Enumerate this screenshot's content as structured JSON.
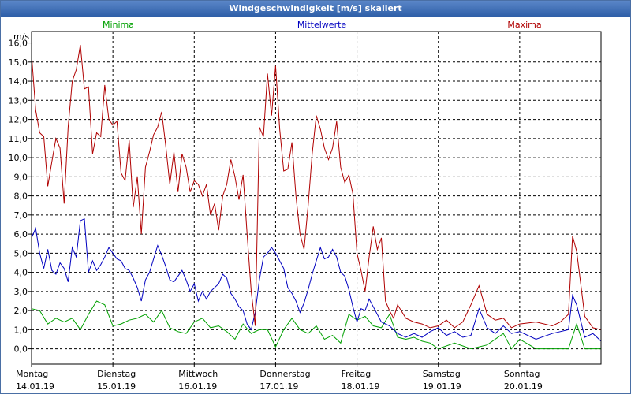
{
  "chart_data": {
    "type": "line",
    "title": "Windgeschwindigkeit [m/s] skaliert",
    "ylabel": "m/s",
    "ylim": [
      -0.8,
      16.6
    ],
    "yticks": [
      "0,0",
      "1,0",
      "2,0",
      "3,0",
      "4,0",
      "5,0",
      "6,0",
      "7,0",
      "8,0",
      "9,0",
      "10,0",
      "11,0",
      "12,0",
      "13,0",
      "14,0",
      "15,0",
      "16,0"
    ],
    "x_days": [
      {
        "day": "Montag",
        "date": "14.01.19"
      },
      {
        "day": "Dienstag",
        "date": "15.01.19"
      },
      {
        "day": "Mittwoch",
        "date": "16.01.19"
      },
      {
        "day": "Donnerstag",
        "date": "17.01.19"
      },
      {
        "day": "Freitag",
        "date": "18.01.19"
      },
      {
        "day": "Samstag",
        "date": "19.01.19"
      },
      {
        "day": "Sonntag",
        "date": "20.01.19"
      }
    ],
    "grid": true,
    "legend": "top",
    "series": [
      {
        "name": "Minima",
        "color": "#00a000",
        "points": [
          [
            14.0,
            2.1
          ],
          [
            14.1,
            2.0
          ],
          [
            14.2,
            1.3
          ],
          [
            14.3,
            1.6
          ],
          [
            14.4,
            1.4
          ],
          [
            14.5,
            1.6
          ],
          [
            14.6,
            1.0
          ],
          [
            14.7,
            1.8
          ],
          [
            14.8,
            2.5
          ],
          [
            14.9,
            2.3
          ],
          [
            15.0,
            1.2
          ],
          [
            15.1,
            1.3
          ],
          [
            15.2,
            1.5
          ],
          [
            15.3,
            1.6
          ],
          [
            15.4,
            1.8
          ],
          [
            15.5,
            1.4
          ],
          [
            15.6,
            2.0
          ],
          [
            15.7,
            1.1
          ],
          [
            15.8,
            0.9
          ],
          [
            15.9,
            0.8
          ],
          [
            16.0,
            1.4
          ],
          [
            16.1,
            1.6
          ],
          [
            16.2,
            1.1
          ],
          [
            16.3,
            1.2
          ],
          [
            16.4,
            0.9
          ],
          [
            16.5,
            0.5
          ],
          [
            16.6,
            1.3
          ],
          [
            16.7,
            0.8
          ],
          [
            16.8,
            1.0
          ],
          [
            16.9,
            1.0
          ],
          [
            17.0,
            0.1
          ],
          [
            17.1,
            1.0
          ],
          [
            17.2,
            1.6
          ],
          [
            17.3,
            1.0
          ],
          [
            17.4,
            0.8
          ],
          [
            17.5,
            1.2
          ],
          [
            17.6,
            0.5
          ],
          [
            17.7,
            0.7
          ],
          [
            17.8,
            0.3
          ],
          [
            17.9,
            1.8
          ],
          [
            18.0,
            1.5
          ],
          [
            18.1,
            1.7
          ],
          [
            18.2,
            1.2
          ],
          [
            18.3,
            1.1
          ],
          [
            18.4,
            1.8
          ],
          [
            18.5,
            0.6
          ],
          [
            18.6,
            0.5
          ],
          [
            18.7,
            0.6
          ],
          [
            18.8,
            0.4
          ],
          [
            18.9,
            0.3
          ],
          [
            19.0,
            0.0
          ],
          [
            19.2,
            0.3
          ],
          [
            19.4,
            0.0
          ],
          [
            19.6,
            0.2
          ],
          [
            19.8,
            0.8
          ],
          [
            19.9,
            0.0
          ],
          [
            20.0,
            0.5
          ],
          [
            20.2,
            0.0
          ],
          [
            20.4,
            0.0
          ],
          [
            20.6,
            0.0
          ],
          [
            20.7,
            1.3
          ],
          [
            20.8,
            0.0
          ],
          [
            21.0,
            0.0
          ]
        ]
      },
      {
        "name": "Mittelwerte",
        "color": "#0000c0",
        "points": [
          [
            14.0,
            5.8
          ],
          [
            14.05,
            6.3
          ],
          [
            14.1,
            5.0
          ],
          [
            14.15,
            4.2
          ],
          [
            14.2,
            5.2
          ],
          [
            14.25,
            4.1
          ],
          [
            14.3,
            3.9
          ],
          [
            14.35,
            4.5
          ],
          [
            14.4,
            4.2
          ],
          [
            14.45,
            3.5
          ],
          [
            14.5,
            5.3
          ],
          [
            14.55,
            4.8
          ],
          [
            14.6,
            6.7
          ],
          [
            14.65,
            6.8
          ],
          [
            14.7,
            4.0
          ],
          [
            14.75,
            4.6
          ],
          [
            14.8,
            4.1
          ],
          [
            14.85,
            4.4
          ],
          [
            14.9,
            4.8
          ],
          [
            14.95,
            5.3
          ],
          [
            15.0,
            5.0
          ],
          [
            15.05,
            4.7
          ],
          [
            15.1,
            4.6
          ],
          [
            15.15,
            4.2
          ],
          [
            15.2,
            4.1
          ],
          [
            15.25,
            3.7
          ],
          [
            15.3,
            3.2
          ],
          [
            15.35,
            2.5
          ],
          [
            15.4,
            3.6
          ],
          [
            15.45,
            4.0
          ],
          [
            15.5,
            4.7
          ],
          [
            15.55,
            5.4
          ],
          [
            15.6,
            4.9
          ],
          [
            15.65,
            4.3
          ],
          [
            15.7,
            3.6
          ],
          [
            15.75,
            3.5
          ],
          [
            15.8,
            3.8
          ],
          [
            15.85,
            4.1
          ],
          [
            15.9,
            3.6
          ],
          [
            15.95,
            3.0
          ],
          [
            16.0,
            3.4
          ],
          [
            16.05,
            2.5
          ],
          [
            16.1,
            3.0
          ],
          [
            16.15,
            2.6
          ],
          [
            16.2,
            3.0
          ],
          [
            16.25,
            3.2
          ],
          [
            16.3,
            3.4
          ],
          [
            16.35,
            3.9
          ],
          [
            16.4,
            3.7
          ],
          [
            16.45,
            2.9
          ],
          [
            16.5,
            2.6
          ],
          [
            16.55,
            2.2
          ],
          [
            16.6,
            2.0
          ],
          [
            16.65,
            1.3
          ],
          [
            16.7,
            1.0
          ],
          [
            16.75,
            1.9
          ],
          [
            16.8,
            3.6
          ],
          [
            16.85,
            4.8
          ],
          [
            16.9,
            5.0
          ],
          [
            16.95,
            5.3
          ],
          [
            17.0,
            5.0
          ],
          [
            17.05,
            4.6
          ],
          [
            17.1,
            4.2
          ],
          [
            17.15,
            3.2
          ],
          [
            17.2,
            2.9
          ],
          [
            17.25,
            2.5
          ],
          [
            17.3,
            1.9
          ],
          [
            17.35,
            2.4
          ],
          [
            17.4,
            3.1
          ],
          [
            17.45,
            3.9
          ],
          [
            17.5,
            4.6
          ],
          [
            17.55,
            5.3
          ],
          [
            17.6,
            4.7
          ],
          [
            17.65,
            4.8
          ],
          [
            17.7,
            5.2
          ],
          [
            17.75,
            4.8
          ],
          [
            17.8,
            4.0
          ],
          [
            17.85,
            3.8
          ],
          [
            17.9,
            3.1
          ],
          [
            17.95,
            2.2
          ],
          [
            18.0,
            1.4
          ],
          [
            18.05,
            2.1
          ],
          [
            18.1,
            2.0
          ],
          [
            18.15,
            2.6
          ],
          [
            18.2,
            2.2
          ],
          [
            18.3,
            1.4
          ],
          [
            18.4,
            1.2
          ],
          [
            18.5,
            0.8
          ],
          [
            18.6,
            0.6
          ],
          [
            18.7,
            0.8
          ],
          [
            18.8,
            0.6
          ],
          [
            18.9,
            0.9
          ],
          [
            19.0,
            1.1
          ],
          [
            19.1,
            0.7
          ],
          [
            19.2,
            0.9
          ],
          [
            19.3,
            0.6
          ],
          [
            19.4,
            0.7
          ],
          [
            19.5,
            2.1
          ],
          [
            19.6,
            1.1
          ],
          [
            19.7,
            0.8
          ],
          [
            19.8,
            1.2
          ],
          [
            19.9,
            0.8
          ],
          [
            20.0,
            0.9
          ],
          [
            20.2,
            0.5
          ],
          [
            20.4,
            0.8
          ],
          [
            20.6,
            1.0
          ],
          [
            20.65,
            2.8
          ],
          [
            20.7,
            2.3
          ],
          [
            20.8,
            0.6
          ],
          [
            20.9,
            0.8
          ],
          [
            21.0,
            0.4
          ]
        ]
      },
      {
        "name": "Maxima",
        "color": "#b00000",
        "points": [
          [
            14.0,
            15.4
          ],
          [
            14.05,
            12.5
          ],
          [
            14.1,
            11.3
          ],
          [
            14.15,
            11.1
          ],
          [
            14.2,
            8.5
          ],
          [
            14.25,
            9.8
          ],
          [
            14.3,
            11.0
          ],
          [
            14.35,
            10.5
          ],
          [
            14.4,
            7.6
          ],
          [
            14.45,
            11.6
          ],
          [
            14.5,
            14.0
          ],
          [
            14.55,
            14.6
          ],
          [
            14.6,
            15.9
          ],
          [
            14.65,
            13.6
          ],
          [
            14.7,
            13.7
          ],
          [
            14.75,
            10.2
          ],
          [
            14.8,
            11.3
          ],
          [
            14.85,
            11.1
          ],
          [
            14.9,
            13.8
          ],
          [
            14.95,
            12.0
          ],
          [
            15.0,
            11.7
          ],
          [
            15.05,
            11.9
          ],
          [
            15.1,
            9.2
          ],
          [
            15.15,
            8.8
          ],
          [
            15.2,
            10.9
          ],
          [
            15.25,
            7.4
          ],
          [
            15.3,
            9.0
          ],
          [
            15.35,
            6.0
          ],
          [
            15.4,
            9.5
          ],
          [
            15.45,
            10.3
          ],
          [
            15.5,
            11.2
          ],
          [
            15.55,
            11.6
          ],
          [
            15.6,
            12.4
          ],
          [
            15.65,
            10.6
          ],
          [
            15.7,
            8.6
          ],
          [
            15.75,
            10.3
          ],
          [
            15.8,
            8.2
          ],
          [
            15.85,
            10.2
          ],
          [
            15.9,
            9.5
          ],
          [
            15.95,
            8.2
          ],
          [
            16.0,
            8.8
          ],
          [
            16.05,
            8.6
          ],
          [
            16.1,
            8.0
          ],
          [
            16.15,
            8.6
          ],
          [
            16.2,
            7.0
          ],
          [
            16.25,
            7.6
          ],
          [
            16.3,
            6.2
          ],
          [
            16.35,
            8.0
          ],
          [
            16.4,
            8.6
          ],
          [
            16.45,
            9.9
          ],
          [
            16.5,
            9.0
          ],
          [
            16.55,
            7.8
          ],
          [
            16.6,
            9.1
          ],
          [
            16.65,
            6.0
          ],
          [
            16.7,
            3.0
          ],
          [
            16.75,
            1.2
          ],
          [
            16.8,
            11.6
          ],
          [
            16.85,
            11.1
          ],
          [
            16.9,
            14.4
          ],
          [
            16.95,
            12.2
          ],
          [
            17.0,
            14.8
          ],
          [
            17.05,
            11.5
          ],
          [
            17.1,
            9.3
          ],
          [
            17.15,
            9.4
          ],
          [
            17.2,
            10.8
          ],
          [
            17.25,
            8.0
          ],
          [
            17.3,
            6.0
          ],
          [
            17.35,
            5.2
          ],
          [
            17.4,
            7.5
          ],
          [
            17.45,
            10.2
          ],
          [
            17.5,
            12.2
          ],
          [
            17.55,
            11.5
          ],
          [
            17.6,
            10.5
          ],
          [
            17.65,
            9.9
          ],
          [
            17.7,
            10.5
          ],
          [
            17.75,
            11.9
          ],
          [
            17.8,
            9.5
          ],
          [
            17.85,
            8.7
          ],
          [
            17.9,
            9.1
          ],
          [
            17.95,
            8.1
          ],
          [
            18.0,
            5.0
          ],
          [
            18.05,
            4.1
          ],
          [
            18.1,
            3.0
          ],
          [
            18.15,
            4.8
          ],
          [
            18.2,
            6.4
          ],
          [
            18.25,
            5.2
          ],
          [
            18.3,
            5.8
          ],
          [
            18.35,
            2.5
          ],
          [
            18.4,
            2.0
          ],
          [
            18.45,
            1.6
          ],
          [
            18.5,
            2.3
          ],
          [
            18.6,
            1.6
          ],
          [
            18.7,
            1.4
          ],
          [
            18.8,
            1.3
          ],
          [
            18.9,
            1.1
          ],
          [
            19.0,
            1.2
          ],
          [
            19.1,
            1.5
          ],
          [
            19.2,
            1.1
          ],
          [
            19.3,
            1.4
          ],
          [
            19.4,
            2.3
          ],
          [
            19.5,
            3.3
          ],
          [
            19.6,
            1.8
          ],
          [
            19.7,
            1.5
          ],
          [
            19.8,
            1.6
          ],
          [
            19.9,
            1.1
          ],
          [
            20.0,
            1.3
          ],
          [
            20.2,
            1.4
          ],
          [
            20.4,
            1.2
          ],
          [
            20.5,
            1.4
          ],
          [
            20.6,
            1.8
          ],
          [
            20.65,
            5.9
          ],
          [
            20.7,
            5.1
          ],
          [
            20.8,
            1.7
          ],
          [
            20.9,
            1.1
          ],
          [
            21.0,
            1.0
          ]
        ]
      }
    ]
  }
}
